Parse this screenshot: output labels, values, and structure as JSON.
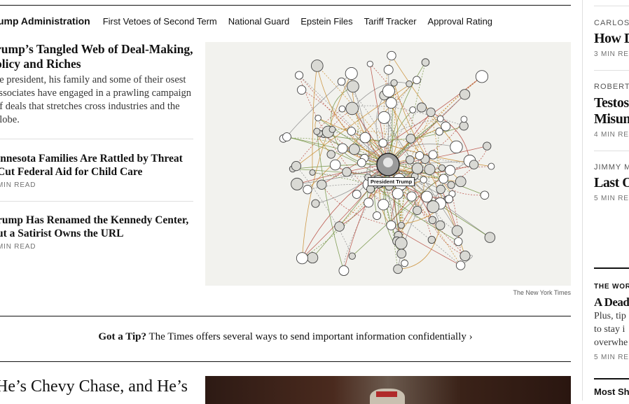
{
  "nav": {
    "section": "ump Administration",
    "links": [
      "First Vetoes of Second Term",
      "National Guard",
      "Epstein Files",
      "Tariff Tracker",
      "Approval Rating"
    ]
  },
  "lead": {
    "title": "rump’s Tangled Web of Deal-Making, olicy and Riches",
    "summary": "he president, his family and some of their osest associates have engaged in a prawling campaign of deals that stretches cross industries and the globe."
  },
  "stories": [
    {
      "title": "innesota Families Are Rattled by Threat Cut Federal Aid for Child Care",
      "read": "MIN READ"
    },
    {
      "title": "rump Has Renamed the Kennedy Center, ut a Satirist Owns the URL",
      "read": "MIN READ"
    }
  ],
  "graphic": {
    "center_label": "President Trump",
    "credit": "The New York Times"
  },
  "tip": {
    "bold": "Got a Tip?",
    "text": "The Times offers several ways to send important information confidentially ›"
  },
  "bottom": {
    "title": "He’s Chevy Chase, and He’s"
  },
  "rail": {
    "items": [
      {
        "author": "CARLOS",
        "title": "How Di",
        "read": "3 MIN RE"
      },
      {
        "author": "ROBERT",
        "title": "Testoste Misund",
        "read": "4 MIN RE"
      },
      {
        "author": "JIMMY M",
        "title": "Last Or",
        "read": "5 MIN RE"
      }
    ],
    "kicker": "THE WOR",
    "feature_title": "A Dead",
    "feature_lines": [
      "Plus, tip",
      "to stay i",
      "overwhe"
    ],
    "feature_read": "5 MIN RE",
    "most": "Most Sh"
  }
}
